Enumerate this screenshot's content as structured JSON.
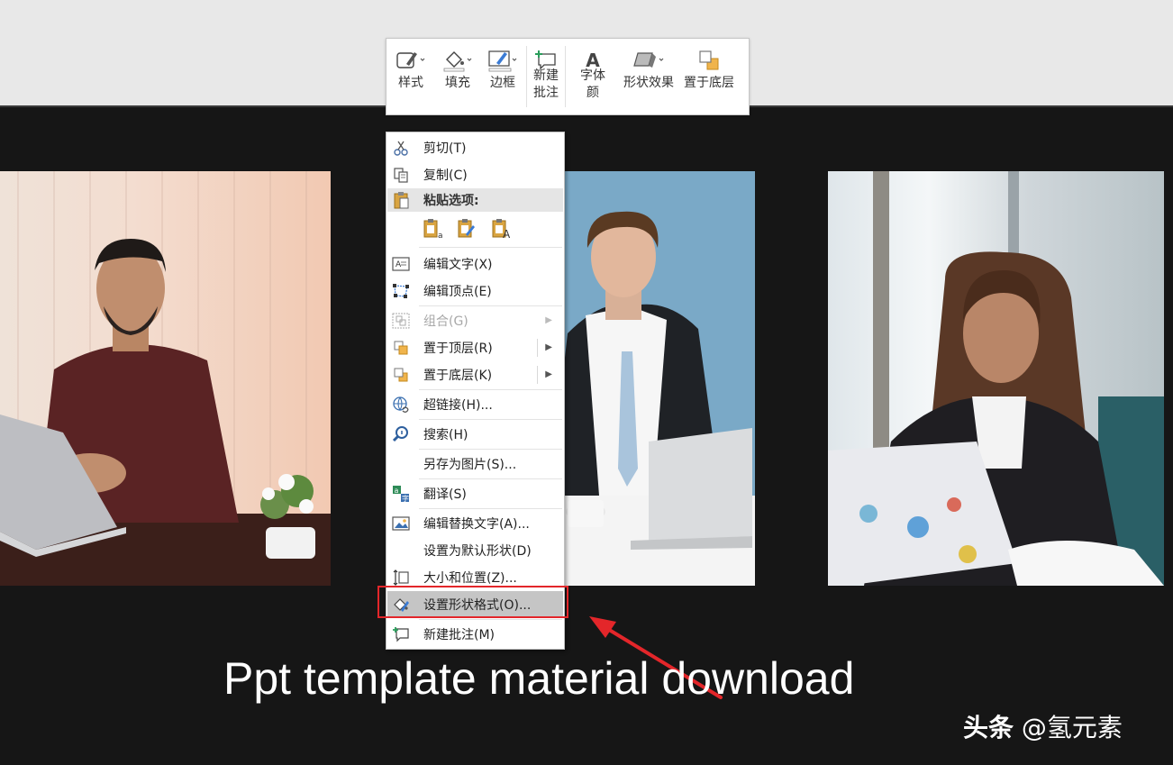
{
  "toolbar": {
    "buttons": [
      {
        "label": "样式"
      },
      {
        "label": "填充"
      },
      {
        "label": "边框"
      },
      {
        "label": "新建\n批注"
      },
      {
        "label": "字体\n颜"
      },
      {
        "label": "形状效果"
      },
      {
        "label": "置于底层"
      }
    ]
  },
  "context_menu": {
    "cut": "剪切(T)",
    "copy": "复制(C)",
    "paste_options": "粘贴选项:",
    "edit_text": "编辑文字(X)",
    "edit_points": "编辑顶点(E)",
    "group": "组合(G)",
    "bring_to_front": "置于顶层(R)",
    "send_to_back": "置于底层(K)",
    "hyperlink": "超链接(H)...",
    "search": "搜索(H)",
    "save_as_picture": "另存为图片(S)...",
    "translate": "翻译(S)",
    "edit_alt_text": "编辑替换文字(A)...",
    "set_default_shape": "设置为默认形状(D)",
    "size_position": "大小和位置(Z)...",
    "format_shape": "设置形状格式(O)...",
    "new_comment": "新建批注(M)"
  },
  "caption": "Ppt template material download",
  "watermark": {
    "brand": "头条",
    "handle": "@氢元素"
  },
  "colors": {
    "highlight_box": "#e3262a",
    "slide_bg": "#161616"
  }
}
